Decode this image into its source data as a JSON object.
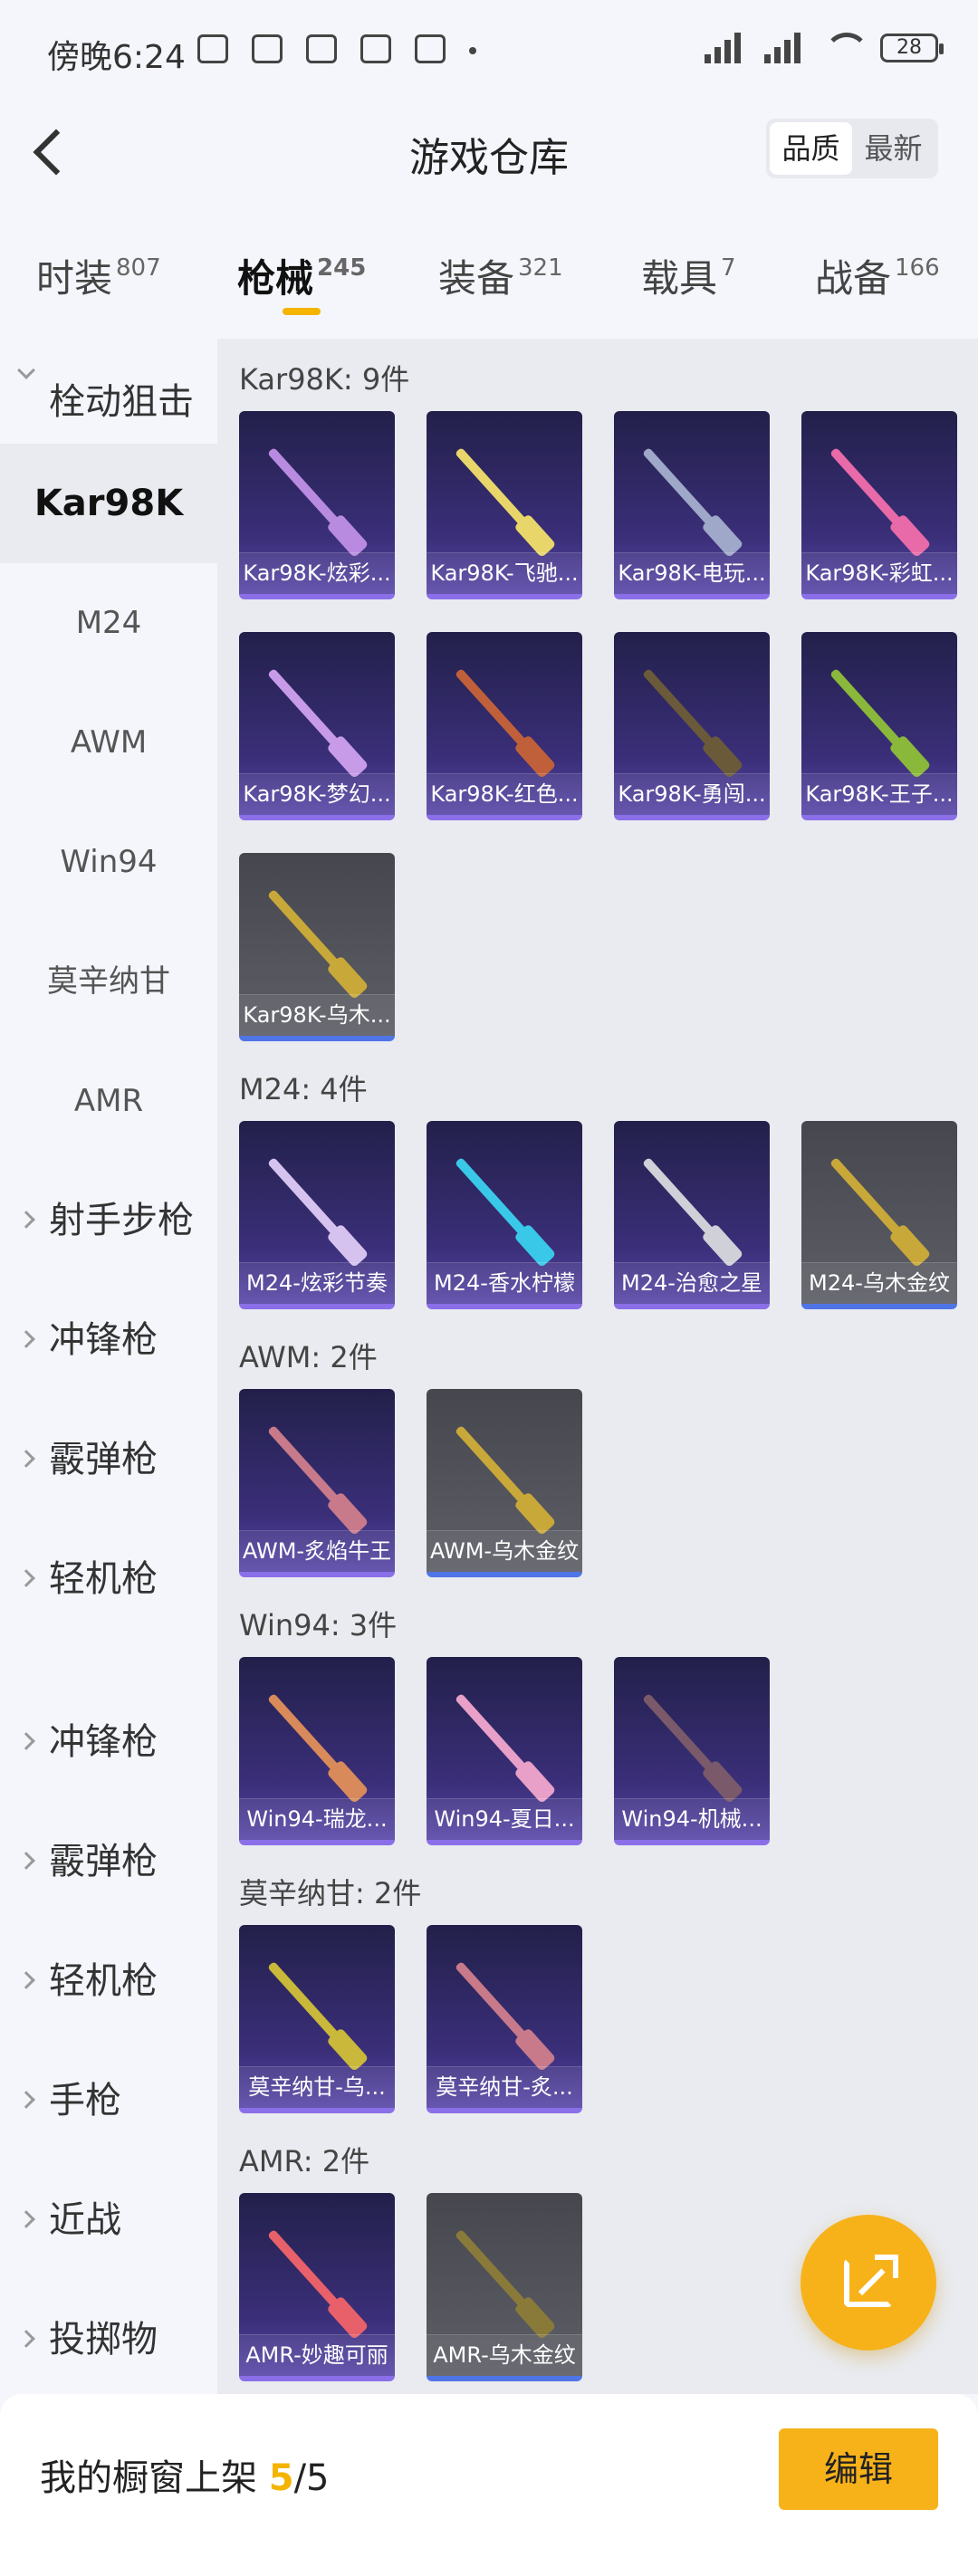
{
  "status_bar": {
    "time": "傍晚6:24",
    "battery": "28"
  },
  "header": {
    "title": "游戏仓库",
    "sort_options": [
      "品质",
      "最新"
    ]
  },
  "tabs": [
    {
      "label": "时装",
      "count": "807"
    },
    {
      "label": "枪械",
      "count": "245"
    },
    {
      "label": "装备",
      "count": "321"
    },
    {
      "label": "载具",
      "count": "7"
    },
    {
      "label": "战备",
      "count": "166"
    }
  ],
  "sidebar": {
    "items": [
      {
        "label": "栓动狙击",
        "type": "group-open"
      },
      {
        "label": "Kar98K",
        "type": "selected"
      },
      {
        "label": "M24",
        "type": "sub"
      },
      {
        "label": "AWM",
        "type": "sub"
      },
      {
        "label": "Win94",
        "type": "sub"
      },
      {
        "label": "莫辛纳甘",
        "type": "sub"
      },
      {
        "label": "AMR",
        "type": "sub"
      },
      {
        "label": "射手步枪",
        "type": "group"
      },
      {
        "label": "冲锋枪",
        "type": "group"
      },
      {
        "label": "霰弹枪",
        "type": "group"
      },
      {
        "label": "轻机枪",
        "type": "group"
      },
      {
        "label": "冲锋枪",
        "type": "group"
      },
      {
        "label": "霰弹枪",
        "type": "group"
      },
      {
        "label": "轻机枪",
        "type": "group"
      },
      {
        "label": "手枪",
        "type": "group"
      },
      {
        "label": "近战",
        "type": "group"
      },
      {
        "label": "投掷物",
        "type": "group"
      }
    ]
  },
  "sections": [
    {
      "label": "Kar98K: 9件",
      "items": [
        {
          "name": "Kar98K-炫彩...",
          "style": "purple",
          "gun": "#b98be0"
        },
        {
          "name": "Kar98K-飞驰...",
          "style": "purple",
          "gun": "#e8d66a"
        },
        {
          "name": "Kar98K-电玩...",
          "style": "purple",
          "gun": "#9fa8c8"
        },
        {
          "name": "Kar98K-彩虹...",
          "style": "purple",
          "gun": "#e86aa8"
        },
        {
          "name": "Kar98K-梦幻...",
          "style": "purple",
          "gun": "#c79be8"
        },
        {
          "name": "Kar98K-红色...",
          "style": "purple",
          "gun": "#c0603a"
        },
        {
          "name": "Kar98K-勇闯...",
          "style": "purple",
          "gun": "#6a5a3a"
        },
        {
          "name": "Kar98K-王子...",
          "style": "purple",
          "gun": "#8ab83a"
        },
        {
          "name": "Kar98K-乌木...",
          "style": "gray",
          "gun": "#c9a83a"
        }
      ]
    },
    {
      "label": "M24: 4件",
      "items": [
        {
          "name": "M24-炫彩节奏",
          "style": "purple",
          "gun": "#d6c2ee"
        },
        {
          "name": "M24-香水柠檬",
          "style": "purple",
          "gun": "#3ac8e8"
        },
        {
          "name": "M24-治愈之星",
          "style": "purple",
          "gun": "#d0d0d8"
        },
        {
          "name": "M24-乌木金纹",
          "style": "gray",
          "gun": "#c9a83a"
        }
      ]
    },
    {
      "label": "AWM: 2件",
      "items": [
        {
          "name": "AWM-炙焰牛王",
          "style": "purple",
          "gun": "#c87a8a"
        },
        {
          "name": "AWM-乌木金纹",
          "style": "gray",
          "gun": "#c9a83a"
        }
      ]
    },
    {
      "label": "Win94: 3件",
      "items": [
        {
          "name": "Win94-瑞龙...",
          "style": "purple",
          "gun": "#d88a5a"
        },
        {
          "name": "Win94-夏日...",
          "style": "purple",
          "gun": "#e8a0c8"
        },
        {
          "name": "Win94-机械...",
          "style": "purple",
          "gun": "#7a5a6a"
        }
      ]
    },
    {
      "label": "莫辛纳甘: 2件",
      "items": [
        {
          "name": "莫辛纳甘-乌...",
          "style": "purple",
          "gun": "#c9b83a"
        },
        {
          "name": "莫辛纳甘-炙...",
          "style": "purple",
          "gun": "#c87a8a"
        }
      ]
    },
    {
      "label": "AMR: 2件",
      "items": [
        {
          "name": "AMR-妙趣可丽",
          "style": "purple",
          "gun": "#e8606a"
        },
        {
          "name": "AMR-乌木金纹",
          "style": "gray",
          "gun": "#8a7a3a"
        }
      ]
    }
  ],
  "bottom_bar": {
    "showcase_label": "我的橱窗上架",
    "current": "5",
    "total": "/5",
    "edit_label": "编辑"
  }
}
